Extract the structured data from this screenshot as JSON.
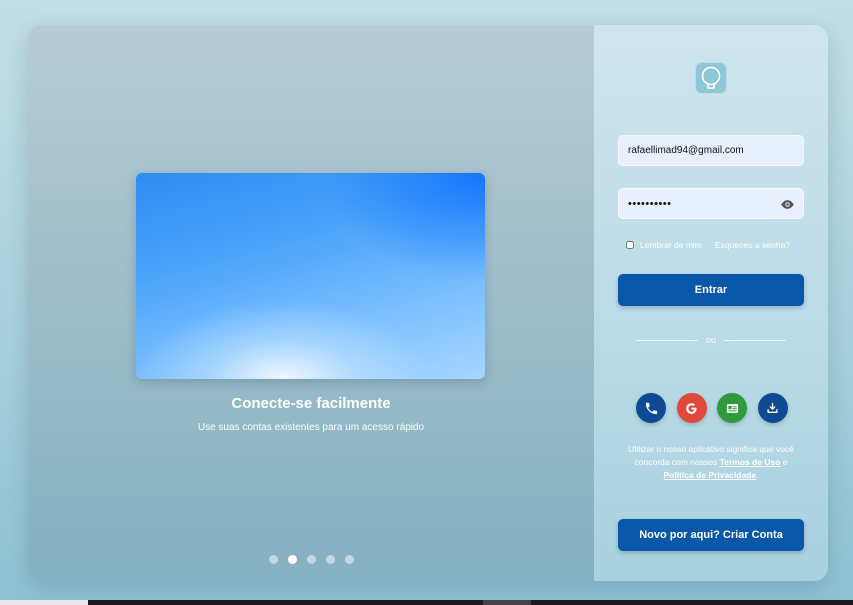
{
  "carousel": {
    "title": "Conecte-se facilmente",
    "subtitle": "Use suas contas existentes para um acesso rápido",
    "slide_count": 5,
    "active_index": 1
  },
  "login": {
    "email_value": "rafaellimad94@gmail.com",
    "password_value": "••••••••••",
    "remember_label": "Lembrar de mim",
    "forgot_label": "Esqueceu a senha?",
    "submit_label": "Entrar",
    "divider_label": "ou",
    "terms_prefix": "Utilizar o nosso aplicativo significa que você concorda com nossos ",
    "terms_link": "Termos de Uso",
    "terms_and": " e ",
    "privacy_link": "Política de Privacidade",
    "terms_suffix": ".",
    "signup_label": "Novo por aqui? Criar Conta"
  },
  "social": {
    "icons": [
      "phone-icon",
      "google-icon",
      "id-card-icon",
      "download-icon"
    ],
    "colors": [
      "#0d4a92",
      "#e2473c",
      "#2f9a3b",
      "#0d4a92"
    ]
  },
  "colors": {
    "primary_button": "#0957a8",
    "input_background": "#e8f0fd"
  }
}
